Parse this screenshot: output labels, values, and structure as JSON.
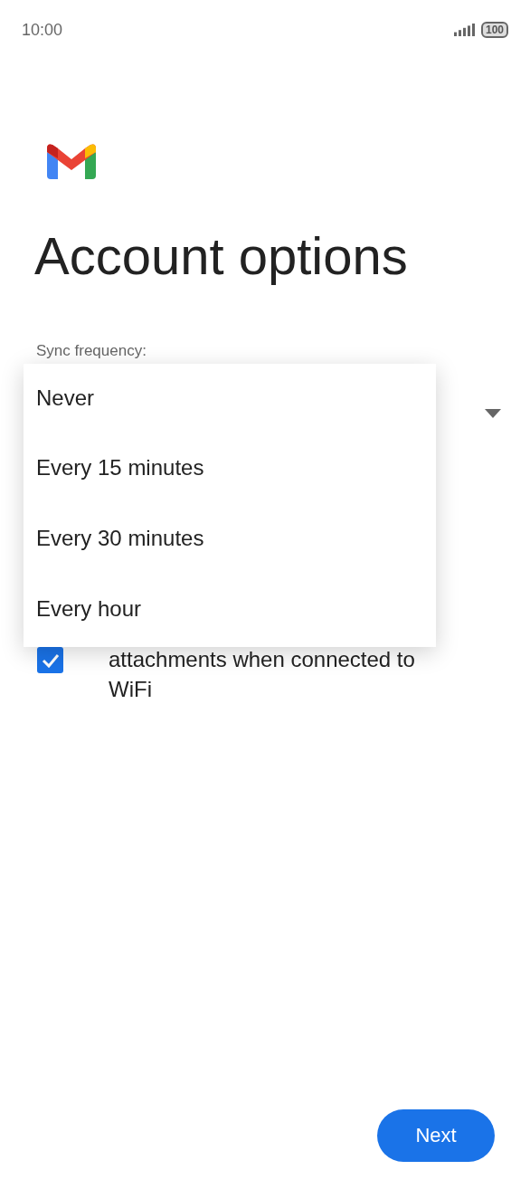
{
  "status_bar": {
    "time": "10:00",
    "battery": "100"
  },
  "title": "Account options",
  "sync": {
    "label": "Sync frequency:",
    "expanded": true,
    "options": [
      {
        "label": "Never"
      },
      {
        "label": "Every 15 minutes"
      },
      {
        "label": "Every 30 minutes"
      },
      {
        "label": "Every hour"
      }
    ]
  },
  "wifi_option": {
    "label": "attachments when connected to WiFi",
    "checked": true
  },
  "next_button": "Next"
}
